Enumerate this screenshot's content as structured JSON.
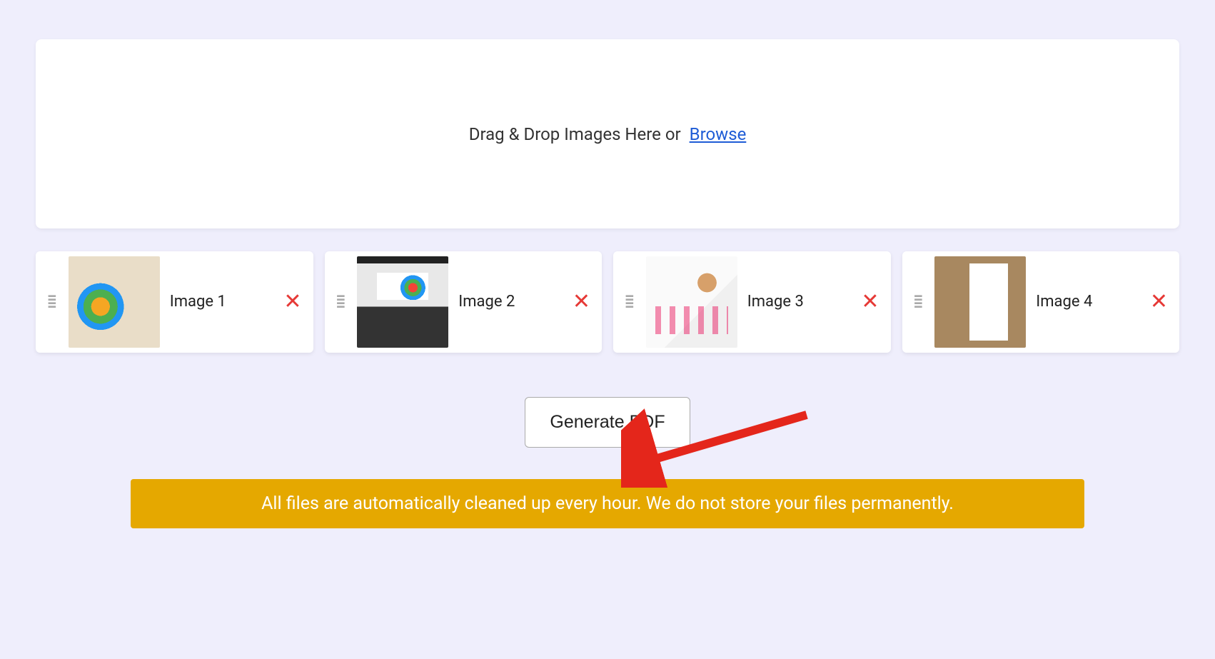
{
  "dropzone": {
    "text": "Drag & Drop Images Here or ",
    "browse_label": "Browse"
  },
  "images": [
    {
      "label": "Image 1"
    },
    {
      "label": "Image 2"
    },
    {
      "label": "Image 3"
    },
    {
      "label": "Image 4"
    }
  ],
  "generate_button_label": "Generate PDF",
  "notice_text": "All files are automatically cleaned up every hour. We do not store your files permanently.",
  "colors": {
    "accent_link": "#1e5cd6",
    "danger": "#e63936",
    "notice_bg": "#e5a800"
  }
}
